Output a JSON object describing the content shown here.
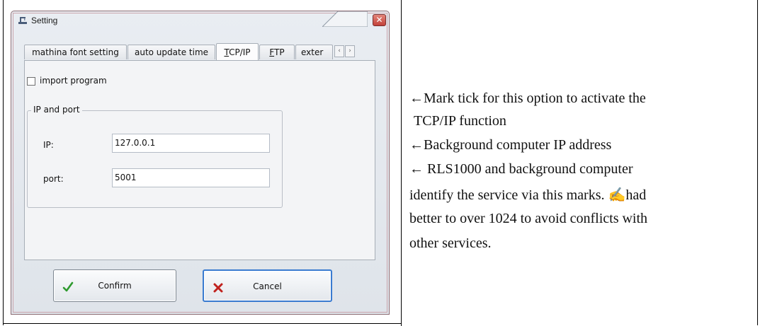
{
  "window": {
    "title": "Setting",
    "close_glyph": "✕"
  },
  "tabs": {
    "items": [
      {
        "label": "mathina font setting"
      },
      {
        "label": "auto update time"
      },
      {
        "label": "TCP/IP",
        "accel": "T",
        "rest": "CP/IP",
        "active": true
      },
      {
        "label": "FTP",
        "accel": "F",
        "rest": "TP"
      },
      {
        "label": "exter"
      }
    ],
    "scroll_left": "‹",
    "scroll_right": "›"
  },
  "panel": {
    "import_checkbox_label": "import program",
    "import_checked": false,
    "group_title": "IP and port",
    "ip_label": "IP:",
    "ip_value": "127.0.0.1",
    "port_label": "port:",
    "port_value": "5001"
  },
  "buttons": {
    "confirm_label": "Confirm",
    "cancel_label": "Cancel"
  },
  "description": {
    "line1": "←Mark tick for this option to activate the",
    "line2": "TCP/IP function",
    "line3": "←Background computer IP address",
    "line4": "← RLS1000 and background computer",
    "line5": "identify the service via this marks. ✍had",
    "line6": "better to over 1024 to avoid conflicts with",
    "line7": "other services."
  },
  "colors": {
    "window_border": "#8a6a72",
    "close_red": "#c2413a",
    "focus_blue": "#3a7bd0",
    "check_green": "#2e9a2e",
    "cross_red": "#c0221e"
  },
  "icons": [
    "setting-window-icon",
    "close-icon",
    "checkmark-icon",
    "cross-icon"
  ]
}
